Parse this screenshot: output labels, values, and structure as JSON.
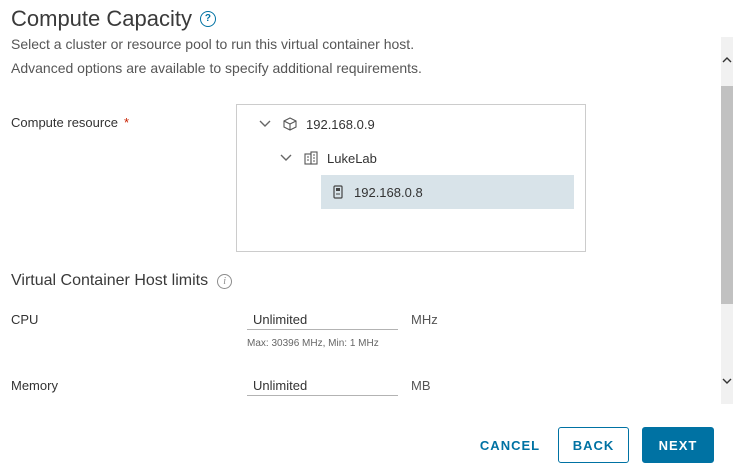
{
  "page": {
    "title": "Compute Capacity",
    "desc_line1": "Select a cluster or resource pool to run this virtual container host.",
    "desc_line2": "Advanced options are available to specify additional requirements."
  },
  "compute_resource": {
    "label": "Compute resource",
    "required_mark": "*",
    "tree": [
      {
        "label": "192.168.0.9",
        "icon": "host-icon",
        "expanded": true
      },
      {
        "label": "LukeLab",
        "icon": "datacenter-icon",
        "expanded": true
      },
      {
        "label": "192.168.0.8",
        "icon": "server-icon",
        "selected": true
      }
    ]
  },
  "limits": {
    "title": "Virtual Container Host limits",
    "cpu": {
      "label": "CPU",
      "value": "Unlimited",
      "unit": "MHz",
      "hint": "Max: 30396 MHz, Min: 1 MHz"
    },
    "memory": {
      "label": "Memory",
      "value": "Unlimited",
      "unit": "MB"
    }
  },
  "footer": {
    "cancel": "CANCEL",
    "back": "BACK",
    "next": "NEXT"
  },
  "colors": {
    "accent": "#0072a3",
    "selected_row": "#d8e3e9",
    "required": "#c92100"
  }
}
